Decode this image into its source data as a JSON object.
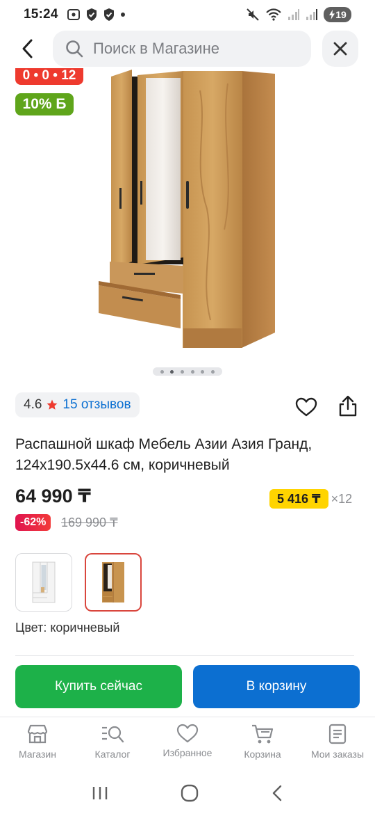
{
  "status_bar": {
    "time": "15:24",
    "battery": "19"
  },
  "search": {
    "placeholder": "Поиск в Магазине"
  },
  "badges": {
    "timer": "0 • 0 • 12",
    "bonus": "10% Б"
  },
  "rating": {
    "value": "4.6",
    "reviews": "15 отзывов"
  },
  "product": {
    "title": "Распашной шкаф Мебель Азии Азия Гранд, 124x190.5x44.6 см, коричневый",
    "price": "64 990 ₸",
    "installment_amount": "5 416 ₸",
    "installment_term": "×12",
    "discount": "-62%",
    "old_price": "169 990 ₸",
    "color_label": "Цвет: коричневый"
  },
  "gallery": {
    "dot_count": 6,
    "active_dot": 1
  },
  "variants": [
    {
      "name": "white",
      "selected": false
    },
    {
      "name": "brown",
      "selected": true
    }
  ],
  "actions": {
    "buy_now": "Купить сейчас",
    "add_to_cart": "В корзину"
  },
  "bottom_nav": [
    {
      "label": "Магазин",
      "icon": "shop-icon"
    },
    {
      "label": "Каталог",
      "icon": "catalog-search-icon"
    },
    {
      "label": "Избранное",
      "icon": "heart-icon"
    },
    {
      "label": "Корзина",
      "icon": "cart-icon"
    },
    {
      "label": "Мои заказы",
      "icon": "orders-icon"
    }
  ],
  "colors": {
    "buy_now": "#1db149",
    "add_to_cart": "#0c6fd1",
    "bonus": "#5fa51b",
    "installment": "#ffd400",
    "timer": "#ee3a2e"
  }
}
